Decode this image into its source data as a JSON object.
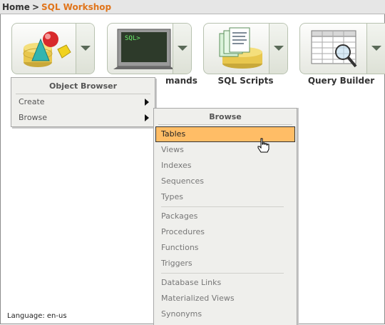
{
  "breadcrumb": {
    "home": "Home",
    "separator": ">",
    "current": "SQL Workshop"
  },
  "tiles": [
    {
      "label": "Object Browser",
      "icon": "object-browser-icon"
    },
    {
      "label": "SQL Commands",
      "visible_label": "mands",
      "icon": "sql-commands-icon",
      "screen_text": "SQL>"
    },
    {
      "label": "SQL Scripts",
      "icon": "sql-scripts-icon"
    },
    {
      "label": "Query Builder",
      "icon": "query-builder-icon"
    }
  ],
  "object_browser_menu": {
    "title": "Object Browser",
    "items": [
      {
        "label": "Create",
        "has_submenu": true
      },
      {
        "label": "Browse",
        "has_submenu": true
      }
    ]
  },
  "browse_menu": {
    "title": "Browse",
    "groups": [
      [
        "Tables",
        "Views",
        "Indexes",
        "Sequences",
        "Types"
      ],
      [
        "Packages",
        "Procedures",
        "Functions",
        "Triggers"
      ],
      [
        "Database Links",
        "Materialized Views",
        "Synonyms"
      ]
    ],
    "highlighted": "Tables"
  },
  "footer": {
    "language": "Language: en-us"
  },
  "colors": {
    "accent": "#e0741a",
    "highlight": "#ffbd66"
  }
}
